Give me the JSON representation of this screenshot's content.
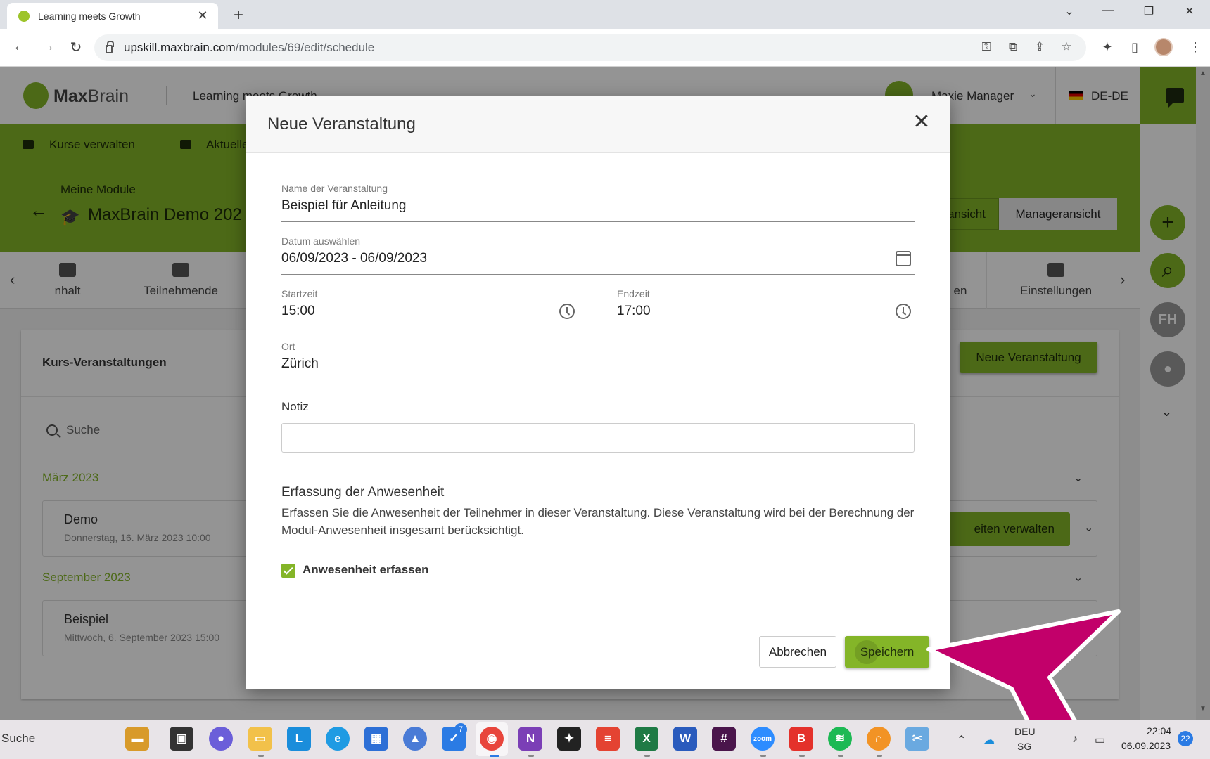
{
  "browser": {
    "tab_title": "Learning meets Growth",
    "url_host": "upskill.maxbrain.com",
    "url_path": "/modules/69/edit/schedule"
  },
  "app": {
    "logo_max": "Max",
    "logo_brain": "Brain",
    "header_title": "Learning meets Growth",
    "user_name": "Maxie Manager",
    "language": "DE-DE",
    "nav": [
      "Kurse verwalten",
      "Aktuelle"
    ],
    "breadcrumb": "Meine Module",
    "module_title": "MaxBrain Demo 202",
    "view_toggle": [
      "ansicht",
      "Manageransicht"
    ],
    "tabs": [
      "nhalt",
      "Teilnehmende",
      "en",
      "Einstellungen"
    ],
    "card_title": "Kurs-Veranstaltungen",
    "new_event_button": "Neue Veranstaltung",
    "search_placeholder": "Suche",
    "months": [
      "März 2023",
      "September 2023"
    ],
    "events": [
      {
        "name": "Demo",
        "date": "Donnerstag, 16. März 2023 10:00"
      },
      {
        "name": "Beispiel",
        "date": "Mittwoch, 6. September 2023 15:00"
      }
    ],
    "manage_button": "eiten verwalten",
    "rail_initials": "FH"
  },
  "modal": {
    "title": "Neue Veranstaltung",
    "close_glyph": "✕",
    "name_label": "Name der Veranstaltung",
    "name_value": "Beispiel für Anleitung",
    "date_label": "Datum auswählen",
    "date_value": "06/09/2023 - 06/09/2023",
    "start_label": "Startzeit",
    "start_value": "15:00",
    "end_label": "Endzeit",
    "end_value": "17:00",
    "place_label": "Ort",
    "place_value": "Zürich",
    "note_label": "Notiz",
    "note_value": "",
    "attendance_title": "Erfassung der Anwesenheit",
    "attendance_desc": "Erfassen Sie die Anwesenheit der Teilnehmer in dieser Veranstaltung. Diese Veranstaltung wird bei der Berechnung der Modul-Anwesenheit insgesamt berücksichtigt.",
    "attendance_checkbox": "Anwesenheit erfassen",
    "attendance_checked": true,
    "cancel": "Abbrechen",
    "save": "Speichern"
  },
  "annotation_color": "#c2006a",
  "accent_color": "#84b528",
  "taskbar": {
    "search": "Suche",
    "todo_badge": "7",
    "lang_top": "DEU",
    "lang_bottom": "SG",
    "time": "22:04",
    "date": "06.09.2023",
    "notifications": "22"
  }
}
